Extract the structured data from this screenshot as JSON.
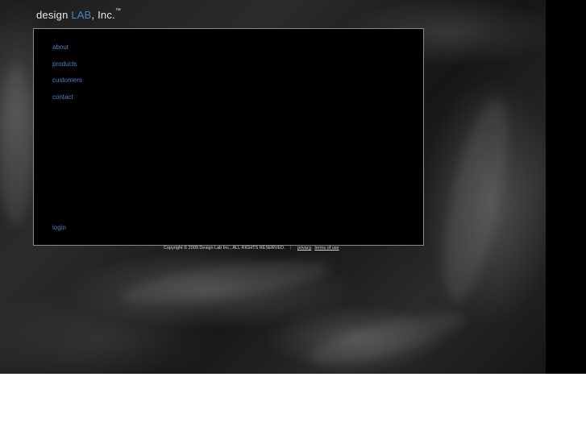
{
  "logo": {
    "part1": "design ",
    "part2": "LAB",
    "part3": ", Inc.",
    "tm": "™"
  },
  "nav": {
    "items": [
      {
        "label": "about"
      },
      {
        "label": "products"
      },
      {
        "label": "customers"
      },
      {
        "label": "contact"
      }
    ],
    "login": "login"
  },
  "footer": {
    "copyright": "Copyright © 2009 Design Lab Inc., ALL RIGHTS RESERVED.",
    "separator": "|",
    "privacy": "privacy",
    "terms": "terms of use"
  },
  "colors": {
    "accent": "#4d7fc0",
    "panel": "#000000",
    "panel_border": "#8a8a8a",
    "text": "#e8e8e8"
  }
}
